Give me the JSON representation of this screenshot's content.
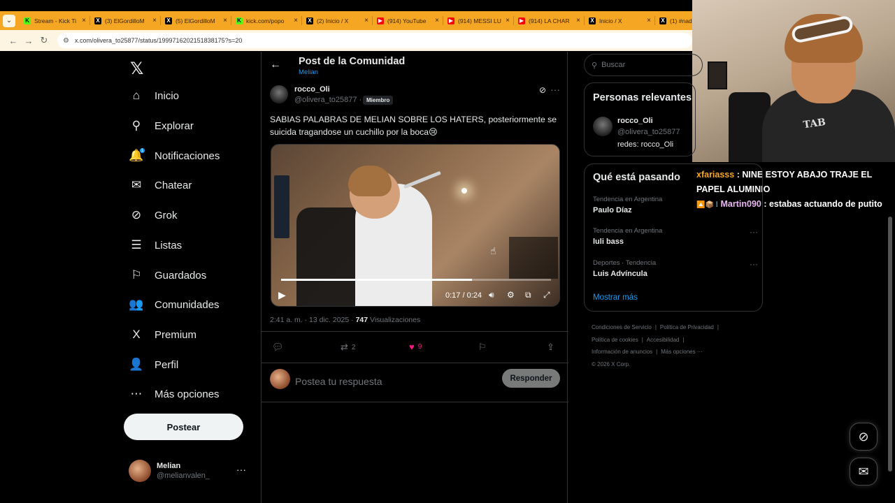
{
  "browser": {
    "tabs": [
      {
        "title": "Stream - Kick Ti",
        "favicon": "K",
        "favicon_color": "#53fc18",
        "favicon_fg": "#000"
      },
      {
        "title": "(3) ElGordilloM",
        "favicon": "X",
        "favicon_color": "#000",
        "favicon_fg": "#fff"
      },
      {
        "title": "(5) ElGordilloM",
        "favicon": "X",
        "favicon_color": "#000",
        "favicon_fg": "#fff"
      },
      {
        "title": "kick.com/popo",
        "favicon": "K",
        "favicon_color": "#53fc18",
        "favicon_fg": "#000"
      },
      {
        "title": "(2) Inicio / X",
        "favicon": "X",
        "favicon_color": "#000",
        "favicon_fg": "#fff"
      },
      {
        "title": "(914) YouTube",
        "favicon": "▶",
        "favicon_color": "#ff0000",
        "favicon_fg": "#fff"
      },
      {
        "title": "(914) MESSI LU",
        "favicon": "▶",
        "favicon_color": "#ff0000",
        "favicon_fg": "#fff"
      },
      {
        "title": "(914) LA CHAR",
        "favicon": "▶",
        "favicon_color": "#ff0000",
        "favicon_fg": "#fff"
      },
      {
        "title": "Inicio / X",
        "favicon": "X",
        "favicon_color": "#000",
        "favicon_fg": "#fff"
      },
      {
        "title": "(1) #nadie",
        "favicon": "X",
        "favicon_color": "#000",
        "favicon_fg": "#fff"
      }
    ],
    "url": "x.com/olivera_to25877/status/1999716202151838175?s=20"
  },
  "chat": [
    {
      "user": "xfariasss",
      "user_color": "#f5a623",
      "message": "NINE ESTOY ABAJO TRAJE EL PAPEL ALUMINIO",
      "badges": ""
    },
    {
      "user": "Martin090",
      "user_color": "#e8b6f0",
      "message": "estabas actuando de putito",
      "badges": "🔼📦 ⁞"
    }
  ],
  "webcam": {
    "shirt_print": "TAB"
  },
  "nav": {
    "items": [
      {
        "label": "Inicio",
        "icon": "⌂",
        "icon_name": "home-icon"
      },
      {
        "label": "Explorar",
        "icon": "⚲",
        "icon_name": "search-icon"
      },
      {
        "label": "Notificaciones",
        "icon": "🔔",
        "icon_name": "bell-icon",
        "badge": "1"
      },
      {
        "label": "Chatear",
        "icon": "✉",
        "icon_name": "mail-icon"
      },
      {
        "label": "Grok",
        "icon": "⊘",
        "icon_name": "grok-icon"
      },
      {
        "label": "Listas",
        "icon": "☰",
        "icon_name": "list-icon"
      },
      {
        "label": "Guardados",
        "icon": "⚐",
        "icon_name": "bookmark-icon"
      },
      {
        "label": "Comunidades",
        "icon": "👥",
        "icon_name": "communities-icon"
      },
      {
        "label": "Premium",
        "icon": "X",
        "icon_name": "x-premium-icon"
      },
      {
        "label": "Perfil",
        "icon": "👤",
        "icon_name": "profile-icon"
      },
      {
        "label": "Más opciones",
        "icon": "⋯",
        "icon_name": "more-options-icon"
      }
    ],
    "post_button": "Postear",
    "account": {
      "name": "Melian",
      "handle": "@melianvalen_"
    }
  },
  "header": {
    "title": "Post de la Comunidad",
    "subtitle": "Melian"
  },
  "post": {
    "author_name": "rocco_Oli",
    "author_handle": "@olivera_to25877",
    "separator": "·",
    "badge": "Miembro",
    "text": "SABIAS PALABRAS DE MELIAN SOBRE LOS HATERS, posteriormente se suicida tragandose un cuchillo por la boca😢",
    "video": {
      "current": "0:17",
      "duration": "0:24",
      "progress": 0.708
    },
    "timestamp": "2:41 a. m. · 13 dic. 2025 · ",
    "views": "747",
    "views_label": "Visualizaciones",
    "reposts": "2",
    "likes": "9",
    "like_color": "#f91880"
  },
  "reply": {
    "placeholder": "Postea tu respuesta",
    "button": "Responder"
  },
  "right": {
    "search_placeholder": "Buscar",
    "relevant_title": "Personas relevantes",
    "relevant_user": {
      "name": "rocco_Oli",
      "handle": "@olivera_to25877",
      "bio": "redes: rocco_Oli"
    },
    "trending_title": "Qué está pasando",
    "trends": [
      {
        "meta": "Tendencia en Argentina",
        "topic": "Paulo Díaz"
      },
      {
        "meta": "Tendencia en Argentina",
        "topic": "luli bass"
      },
      {
        "meta": "Deportes · Tendencia",
        "topic": "Luis Advíncula"
      }
    ],
    "show_more": "Mostrar más",
    "footer_links": [
      "Condiciones de Servicio",
      "Política de Privacidad",
      "Política de cookies",
      "Accesibilidad",
      "Información de anuncios",
      "Más opciones ···"
    ],
    "copyright": "© 2026 X Corp."
  },
  "colors": {
    "accent": "#1d9bf0",
    "tabbar": "#f5a623"
  }
}
